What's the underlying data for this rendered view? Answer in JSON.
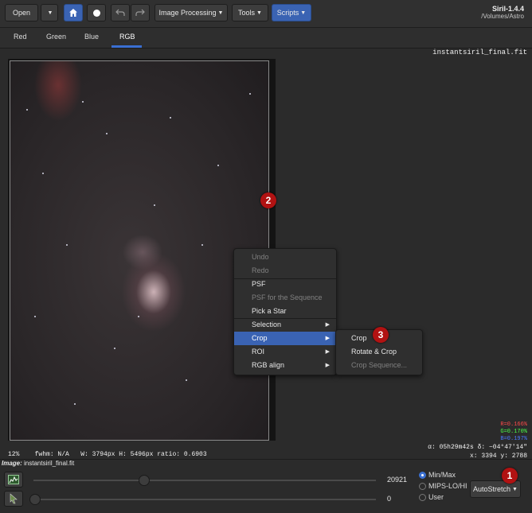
{
  "toolbar": {
    "open_label": "Open",
    "image_processing_label": "Image Processing",
    "tools_label": "Tools",
    "scripts_label": "Scripts"
  },
  "window": {
    "app_title": "Siril-1.4.4",
    "path": "/Volumes/Astro"
  },
  "tabs": [
    {
      "label": "Red"
    },
    {
      "label": "Green"
    },
    {
      "label": "Blue"
    },
    {
      "label": "RGB"
    }
  ],
  "viewer": {
    "filename": "instantsiril_final.fit",
    "zoom": "12%",
    "fwhm": "fwhm: N/A",
    "dimensions": "W: 3794px H: 5496px ratio: 0.6903",
    "coords_radec": "α: 05h29m42s δ: −04°47'14\"",
    "coords_xy": "x: 3394 y: 2788",
    "stats": {
      "r": "R=0.166%",
      "g": "G=0.170%",
      "b": "B=0.197%"
    },
    "colors": {
      "r": "#ff4a4a",
      "g": "#4aff4a",
      "b": "#4a7aff"
    }
  },
  "context_menu": {
    "items": [
      {
        "label": "Undo"
      },
      {
        "label": "Redo"
      },
      {
        "label": "PSF"
      },
      {
        "label": "PSF for the Sequence"
      },
      {
        "label": "Pick a Star"
      },
      {
        "label": "Selection"
      },
      {
        "label": "Crop"
      },
      {
        "label": "ROI"
      },
      {
        "label": "RGB align"
      }
    ]
  },
  "crop_submenu": {
    "items": [
      {
        "label": "Crop"
      },
      {
        "label": "Rotate & Crop"
      },
      {
        "label": "Crop Sequence..."
      }
    ]
  },
  "annotations": [
    "1",
    "2",
    "3"
  ],
  "bottom": {
    "image_label": "Image:",
    "image_name": "instantsiril_final.fit",
    "max_value": "20921",
    "min_value": "0",
    "modes": [
      "Min/Max",
      "MIPS-LO/HI",
      "User"
    ],
    "autostretch_label": "AutoStretch"
  }
}
